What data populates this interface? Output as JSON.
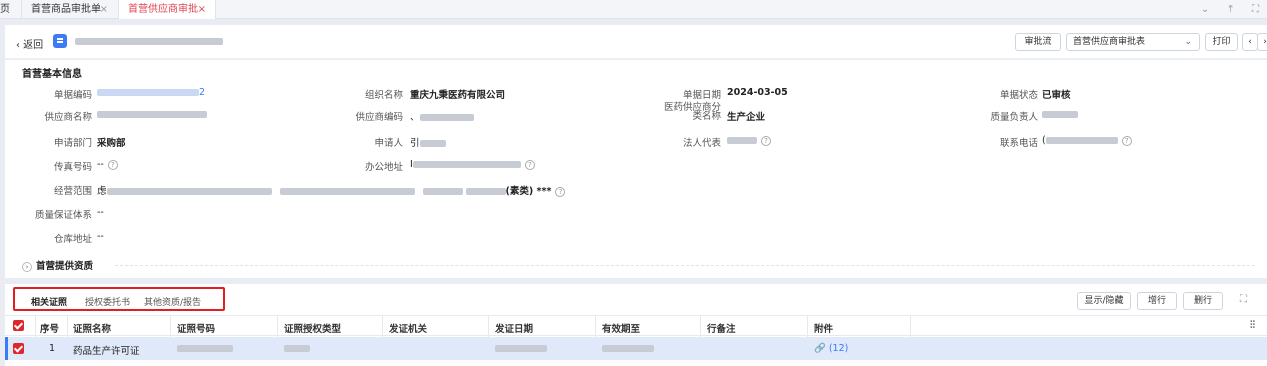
{
  "tabs": {
    "home": "页",
    "items": [
      {
        "label": "首营商品审批单",
        "close": "×"
      },
      {
        "label": "首营供应商审批",
        "close": "×"
      }
    ]
  },
  "header": {
    "back_label": "‹ 返回",
    "buttons": {
      "flow": "审批流",
      "select_value": "首营供应商审批表",
      "select_caret": "⌄",
      "print": "打印",
      "prev": "‹",
      "next": "›"
    }
  },
  "basic_info": {
    "title": "首营基本信息",
    "fields": {
      "doc_no": {
        "label": "单据编码",
        "value": "2"
      },
      "org": {
        "label": "组织名称",
        "value": "重庆九秉医药有限公司"
      },
      "doc_date": {
        "label": "单据日期",
        "value": "2024-03-05"
      },
      "doc_status": {
        "label": "单据状态",
        "value": "已审核"
      },
      "supplier_name": {
        "label": "供应商名称"
      },
      "supplier_code": {
        "label": "供应商编码",
        "value": "、"
      },
      "supplier_cat": {
        "label_l1": "医药供应商分",
        "label_l2": "类名称",
        "value": "生产企业"
      },
      "quality_mgr": {
        "label": "质量负责人"
      },
      "dept": {
        "label": "申请部门",
        "value": "采购部"
      },
      "applicant": {
        "label": "申请人",
        "value": "引"
      },
      "legal_rep": {
        "label": "法人代表"
      },
      "phone": {
        "label": "联系电话",
        "value": "("
      },
      "fax": {
        "label": "传真号码",
        "value": "--"
      },
      "office_addr": {
        "label": "办公地址",
        "value": "I"
      },
      "scope": {
        "label": "经营范围",
        "value_start": "虑",
        "value_end": "(素类) ***"
      },
      "qa_system": {
        "label": "质量保证体系",
        "value": "--"
      },
      "warehouse": {
        "label": "仓库地址",
        "value": "--"
      }
    },
    "help_glyph": "?",
    "collapse_arrow": "›",
    "collapse_label": "首营提供资质"
  },
  "lower": {
    "subtabs": [
      "相关证照",
      "授权委托书",
      "其他资质/报告"
    ],
    "buttons": {
      "toggle": "显示/隐藏",
      "add": "增行",
      "delete": "删行"
    },
    "expand_icon": "⛶",
    "settings_icon": "⫶⫶",
    "columns": [
      "序号",
      "证照名称",
      "证照号码",
      "证照授权类型",
      "发证机关",
      "发证日期",
      "有效期至",
      "行备注",
      "附件"
    ],
    "rows": [
      {
        "index": "1",
        "name": "药品生产许可证",
        "attachment": "🔗 (12)"
      }
    ]
  },
  "tabbar_icons": [
    "⌄",
    "⤒",
    "⛶"
  ],
  "colors": {
    "accent": "#e0454f",
    "primary": "#3c7bf5",
    "checkbox": "#e0252f",
    "selected_row": "#dfe9f9"
  }
}
